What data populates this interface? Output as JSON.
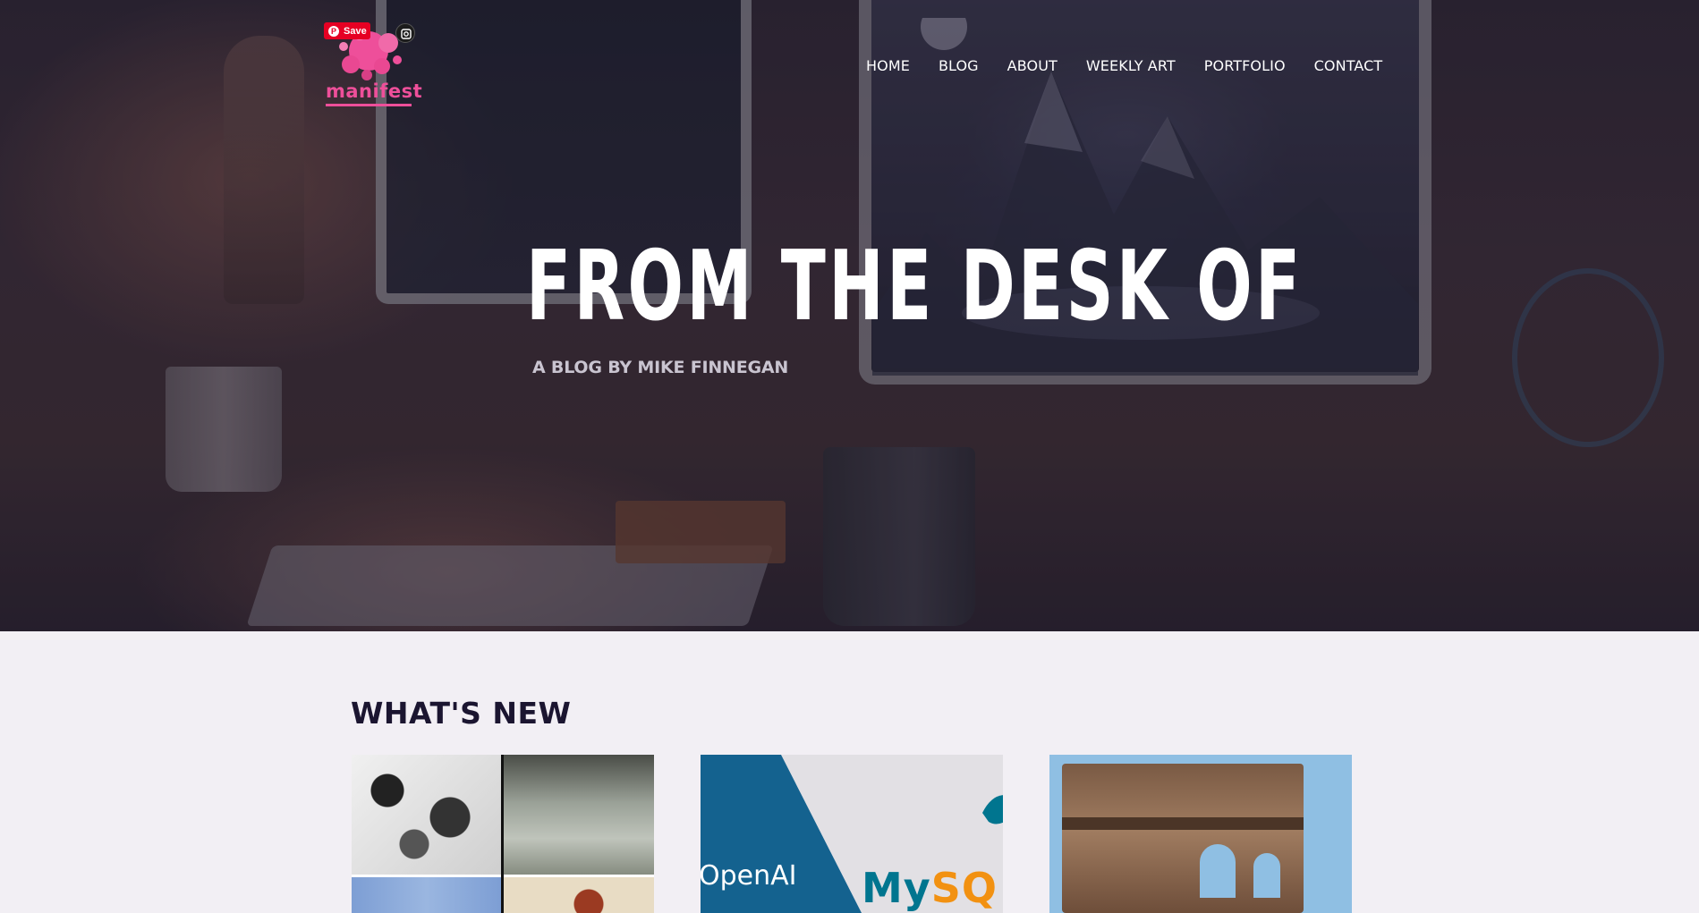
{
  "header": {
    "logo_text": "manifest",
    "pin_save_label": "Save",
    "nav": [
      "HOME",
      "BLOG",
      "ABOUT",
      "WEEKLY ART",
      "PORTFOLIO",
      "CONTACT"
    ]
  },
  "hero": {
    "title": "FROM THE DESK OF",
    "subtitle": "A BLOG BY MIKE FINNEGAN"
  },
  "whats_new": {
    "title": "WHAT'S NEW",
    "cards": [
      {
        "image": "art-collage-thumbnail"
      },
      {
        "image": "openai-mysql-thumbnail",
        "left_text": "OpenAI",
        "right_text_a": "My",
        "right_text_b": "SQ"
      },
      {
        "image": "wooden-stocks-thumbnail"
      }
    ]
  },
  "colors": {
    "brand_pink": "#ee4f9a",
    "pinterest_red": "#e60023",
    "section_bg": "#f2eff4",
    "heading_dark": "#1b1530",
    "mysql_blue": "#00758f",
    "mysql_orange": "#f29111"
  }
}
